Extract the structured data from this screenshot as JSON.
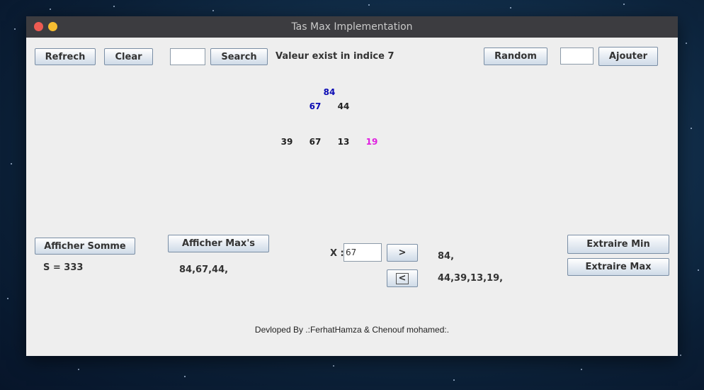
{
  "window": {
    "title": "Tas Max Implementation"
  },
  "toolbar": {
    "refresh_label": "Refrech",
    "clear_label": "Clear",
    "search_input_value": "",
    "search_label": "Search",
    "search_status": "Valeur exist in indice 7",
    "random_label": "Random",
    "add_input_value": "",
    "add_label": "Ajouter"
  },
  "heap": {
    "root": "84",
    "level1": [
      "67",
      "44"
    ],
    "level2": [
      "39",
      "67",
      "13",
      "19"
    ],
    "colors": {
      "highlight": "#0b0bb4",
      "found": "#e01fe0",
      "normal": "#222222"
    }
  },
  "sum": {
    "button_label": "Afficher Somme",
    "result": "S = 333"
  },
  "maxs": {
    "button_label": "Afficher Max's",
    "result": "84,67,44,"
  },
  "compare": {
    "x_label": "X :",
    "x_value": "67",
    "greater_label": ">",
    "less_label": "<",
    "greater_result": "84,",
    "less_result": "44,39,13,19,"
  },
  "extract": {
    "min_label": "Extraire Min",
    "max_label": "Extraire Max"
  },
  "footer": {
    "credits": "Devloped By .:FerhatHamza & Chenouf mohamed:."
  }
}
